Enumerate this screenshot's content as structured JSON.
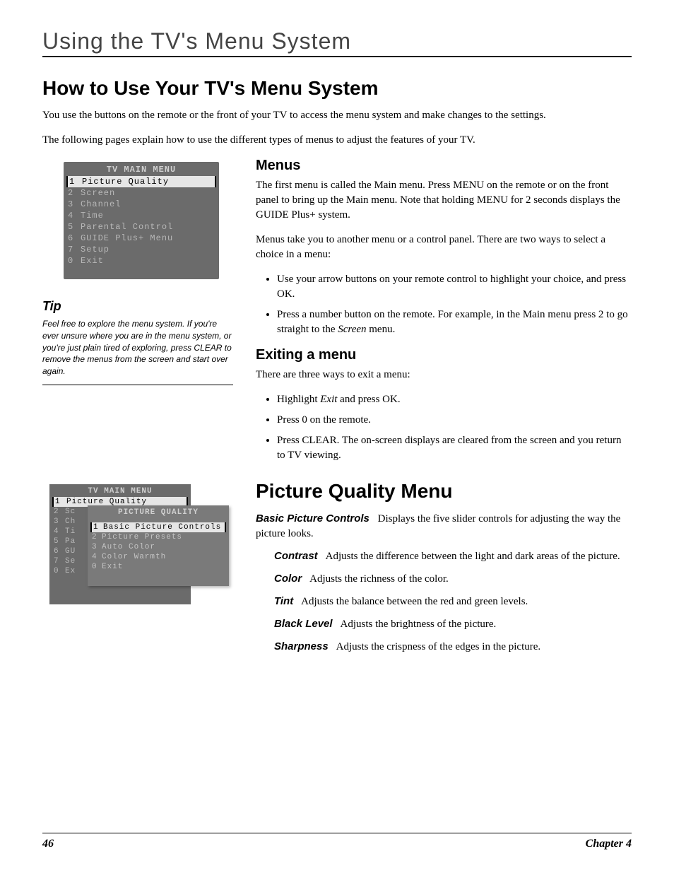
{
  "chapter_header": "Using the TV's Menu System",
  "h1": "How to Use Your TV's Menu System",
  "intro_p1": "You use the buttons on the remote or the front of your TV to access the menu system and make changes to the settings.",
  "intro_p2": "The following pages explain how to use the different types of menus to adjust the features of your TV.",
  "main_menu": {
    "title": "TV MAIN MENU",
    "items": [
      {
        "n": "1",
        "label": "Picture Quality",
        "selected": true
      },
      {
        "n": "2",
        "label": "Screen"
      },
      {
        "n": "3",
        "label": "Channel"
      },
      {
        "n": "4",
        "label": "Time"
      },
      {
        "n": "5",
        "label": "Parental Control"
      },
      {
        "n": "6",
        "label": "GUIDE Plus+ Menu"
      },
      {
        "n": "7",
        "label": "Setup"
      },
      {
        "n": "0",
        "label": "Exit"
      }
    ]
  },
  "tip": {
    "heading": "Tip",
    "body": "Feel free to explore the menu system. If you're ever unsure where you are in the menu system, or you're just plain tired of exploring, press CLEAR to remove the menus from the screen and start over again."
  },
  "menus_h": "Menus",
  "menus_p1": "The first menu is called the Main menu. Press MENU on the remote or on the front panel to bring up the Main menu. Note that holding MENU for 2 seconds displays the GUIDE Plus+ system.",
  "menus_p2": "Menus take you to another menu or a control panel. There are two ways to select a choice in a menu:",
  "menus_b1": "Use your arrow buttons on your remote control to highlight your choice, and press OK.",
  "menus_b2_pre": "Press a number button on the remote. For example, in the Main menu press 2 to go straight to the ",
  "menus_b2_italic": "Screen",
  "menus_b2_post": " menu.",
  "exit_h": "Exiting a menu",
  "exit_p": "There are three ways to exit a menu:",
  "exit_b1_pre": "Highlight ",
  "exit_b1_italic": "Exit",
  "exit_b1_post": " and press OK.",
  "exit_b2": "Press 0 on the remote.",
  "exit_b3": "Press CLEAR. The on-screen displays are cleared from the screen and you return to TV viewing.",
  "sub_menu": {
    "outer_title": "TV MAIN MENU",
    "outer_items": [
      {
        "n": "1",
        "label": "Picture Quality",
        "selected": true
      },
      {
        "n": "2",
        "label": "Sc"
      },
      {
        "n": "3",
        "label": "Ch"
      },
      {
        "n": "4",
        "label": "Ti"
      },
      {
        "n": "5",
        "label": "Pa"
      },
      {
        "n": "6",
        "label": "GU"
      },
      {
        "n": "7",
        "label": "Se"
      },
      {
        "n": "0",
        "label": "Ex"
      }
    ],
    "inner_title": "PICTURE QUALITY",
    "inner_items": [
      {
        "n": "1",
        "label": "Basic Picture Controls",
        "selected": true
      },
      {
        "n": "2",
        "label": "Picture Presets"
      },
      {
        "n": "3",
        "label": "Auto Color"
      },
      {
        "n": "4",
        "label": "Color Warmth"
      },
      {
        "n": "0",
        "label": "Exit"
      }
    ]
  },
  "pq_h1": "Picture Quality Menu",
  "pq_main_term": "Basic Picture Controls",
  "pq_main_desc": "Displays the five slider controls for adjusting the way the picture looks.",
  "pq_defs": [
    {
      "term": "Contrast",
      "desc": "Adjusts the difference between the light and dark areas of the picture."
    },
    {
      "term": "Color",
      "desc": "Adjusts the richness of the color."
    },
    {
      "term": "Tint",
      "desc": "Adjusts the balance between the red and green levels."
    },
    {
      "term": "Black Level",
      "desc": "Adjusts the brightness of the picture."
    },
    {
      "term": "Sharpness",
      "desc": "Adjusts the crispness of the edges in the picture."
    }
  ],
  "footer": {
    "page": "46",
    "chapter": "Chapter 4"
  }
}
